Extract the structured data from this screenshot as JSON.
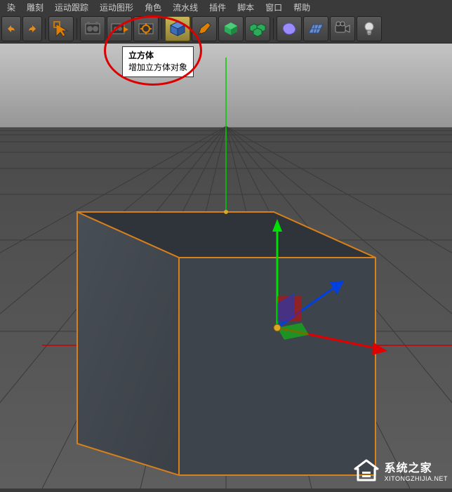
{
  "menu": {
    "items": [
      "染",
      "雕刻",
      "运动跟踪",
      "运动图形",
      "角色",
      "流水线",
      "插件",
      "脚本",
      "窗口",
      "帮助"
    ]
  },
  "toolbar": {
    "undo": "undo",
    "redo": "redo"
  },
  "tooltip": {
    "title": "立方体",
    "desc": "增加立方体对象"
  },
  "watermark": {
    "cn": "系统之家",
    "en": "XITONGZHIJIA.NET"
  }
}
